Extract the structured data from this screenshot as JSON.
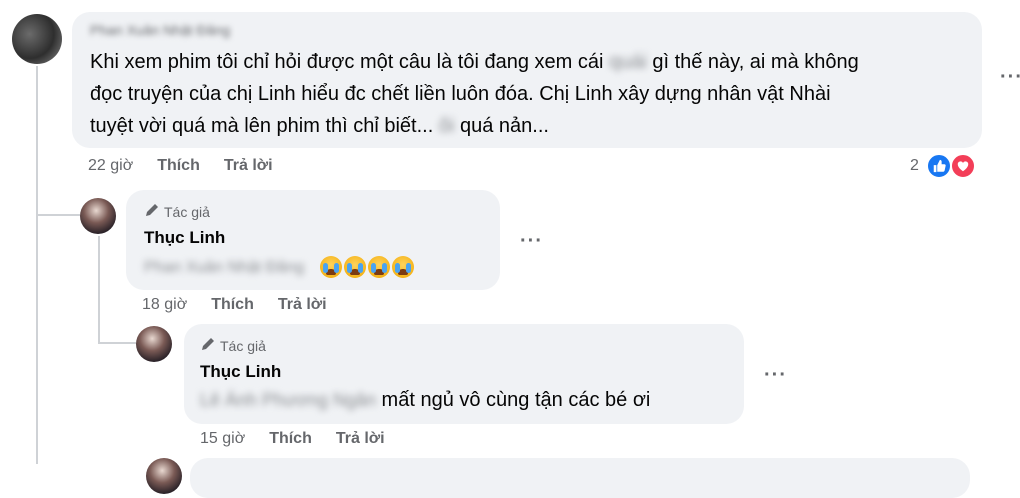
{
  "comment1": {
    "author_blurred": "Phan Xuân Nhật Đăng",
    "text_part1": "Khi xem phim tôi chỉ hỏi được một câu là tôi đang xem cái ",
    "text_blur1": "quái",
    "text_part2": " gì thế này, ai mà không",
    "text_line2": "đọc truyện của chị Linh hiểu đc chết liền luôn đóa. Chị Linh xây dựng nhân vật Nhài",
    "text_line3_a": "tuyệt vời quá mà lên phim thì chỉ biết... ",
    "text_blur2": "ôi",
    "text_line3_b": " quá nản...",
    "time": "22 giờ",
    "like": "Thích",
    "reply": "Trả lời",
    "reaction_count": "2",
    "more": "···"
  },
  "reply1": {
    "badge": "Tác giả",
    "author": "Thục Linh",
    "mention_blurred": "Phan Xuân Nhật Đăng",
    "time": "18 giờ",
    "like": "Thích",
    "reply": "Trả lời",
    "more": "···"
  },
  "reply2": {
    "badge": "Tác giả",
    "author": "Thục Linh",
    "mention_blurred": "Lê Ánh Phương Ngân",
    "text": "mất ngủ vô cùng tận các bé ơi",
    "time": "15 giờ",
    "like": "Thích",
    "reply": "Trả lời",
    "more": "···"
  },
  "icons": {
    "pencil": "pencil-icon",
    "like": "like-reaction-icon",
    "heart": "love-reaction-icon",
    "crying": "crying-face-emoji"
  },
  "colors": {
    "bubble": "#f0f2f5",
    "meta": "#65676b",
    "like_blue": "#1877f2",
    "love_red": "#f33e58"
  }
}
